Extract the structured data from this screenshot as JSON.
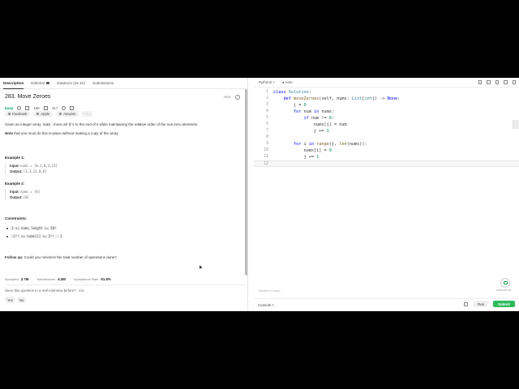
{
  "tabs": [
    {
      "label": "Description",
      "active": true
    },
    {
      "label": "Editorial",
      "active": false
    },
    {
      "label": "Solutions (15.1K)",
      "active": false
    },
    {
      "label": "Submissions",
      "active": false
    }
  ],
  "problem": {
    "title": "283. Move Zeroes",
    "hint_label": "Hint",
    "difficulty": "Easy",
    "likes": "16K",
    "dislikes": "417",
    "companies": [
      "Facebook",
      "Apple",
      "Amazon"
    ],
    "more_label": "···",
    "desc_pre": "Given an integer array ",
    "desc_code1": "nums",
    "desc_mid": ", move all ",
    "desc_code2": "0",
    "desc_post": "'s to the end of it while maintaining the relative order of the non-zero elements.",
    "note_label": "Note",
    "note_text": " that you must do this in-place without making a copy of the array.",
    "examples": [
      {
        "title": "Example 1:",
        "input_label": "Input:",
        "input": "nums = [0,1,0,3,12]",
        "output_label": "Output:",
        "output": "[1,3,12,0,0]"
      },
      {
        "title": "Example 2:",
        "input_label": "Input:",
        "input": "nums = [0]",
        "output_label": "Output:",
        "output": "[0]"
      }
    ],
    "constraints_title": "Constraints:",
    "constraints": [
      "1 <= nums.length <= 10⁴",
      "-2³¹ <= nums[i] <= 2³¹ - 1"
    ],
    "followup_label": "Follow up:",
    "followup_text": " Could you minimize the total number of operations done?",
    "stats": [
      {
        "label": "Accepted",
        "value": "2.7M"
      },
      {
        "label": "Submissions",
        "value": "4.4M"
      },
      {
        "label": "Acceptance Rate",
        "value": "61.5%"
      }
    ],
    "seen_question": "Seen this question in a real interview before?",
    "seen_pages": "1/4",
    "yes_label": "Yes",
    "no_label": "No"
  },
  "editor": {
    "language": "Python3",
    "autocomplete": "Auto",
    "status_text": "Saved to cloud",
    "chat_label": "Leetcode bot",
    "console_label": "Console",
    "run_label": "Run",
    "submit_label": "Submit",
    "line_numbers": [
      "1",
      "2",
      "3",
      "4",
      "5",
      "6",
      "7",
      "8",
      "9",
      "10",
      "11",
      "12"
    ]
  },
  "colors": {
    "easy": "#00a370",
    "submit": "#2cbb5d",
    "keyword": "#0000ff"
  }
}
